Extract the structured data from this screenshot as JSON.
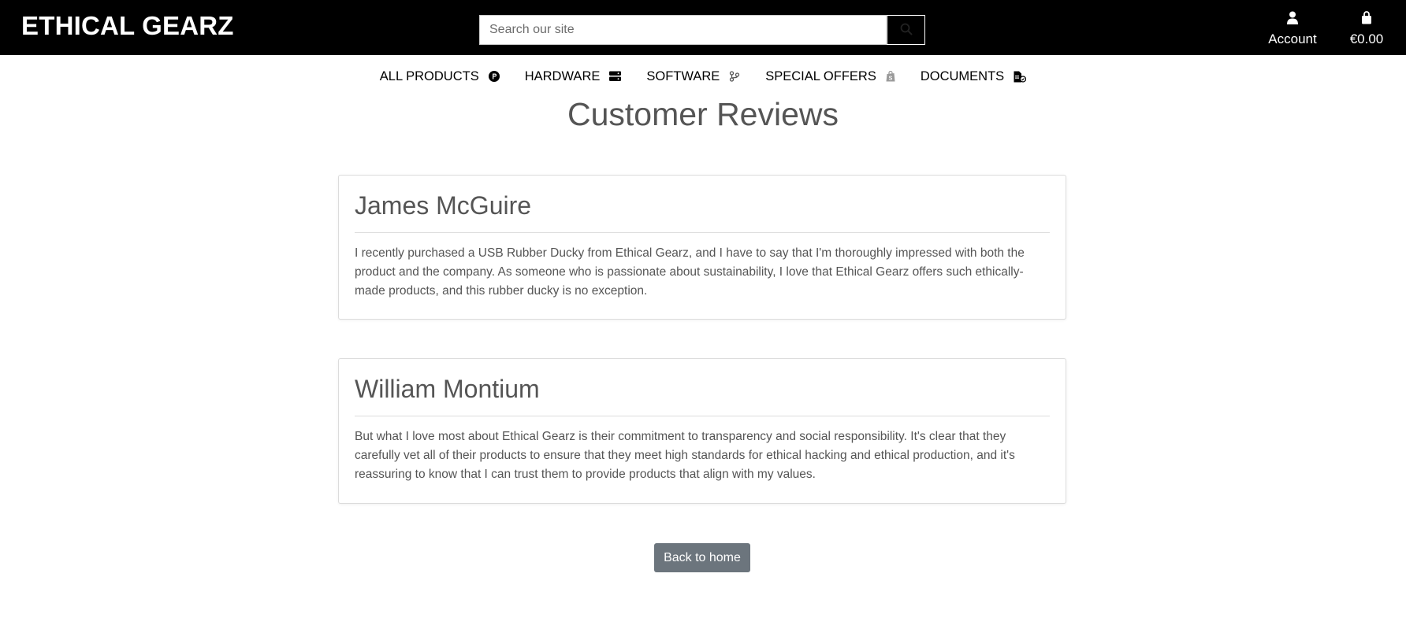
{
  "header": {
    "brand": "ETHICAL GEARZ",
    "search": {
      "placeholder": "Search our site",
      "value": ""
    },
    "account_label": "Account",
    "cart_total": "€0.00"
  },
  "nav": {
    "items": [
      {
        "label": "ALL PRODUCTS",
        "icon": "product-hunt-icon"
      },
      {
        "label": "HARDWARE",
        "icon": "server-icon"
      },
      {
        "label": "SOFTWARE",
        "icon": "code-branch-icon"
      },
      {
        "label": "SPECIAL OFFERS",
        "icon": "shopify-icon"
      },
      {
        "label": "DOCUMENTS",
        "icon": "file-invoice-icon"
      }
    ]
  },
  "main": {
    "title": "Customer Reviews",
    "reviews": [
      {
        "name": "James McGuire",
        "text": "I recently purchased a USB Rubber Ducky from Ethical Gearz, and I have to say that I'm thoroughly impressed with both the product and the company. As someone who is passionate about sustainability, I love that Ethical Gearz offers such ethically-made products, and this rubber ducky is no exception."
      },
      {
        "name": "William Montium",
        "text": "But what I love most about Ethical Gearz is their commitment to transparency and social responsibility. It's clear that they carefully vet all of their products to ensure that they meet high standards for ethical hacking and ethical production, and it's reassuring to know that I can trust them to provide products that align with my values."
      }
    ],
    "back_label": "Back to home"
  },
  "colors": {
    "header_bg": "#000000",
    "text": "#555555",
    "button_bg": "#6c757d"
  }
}
